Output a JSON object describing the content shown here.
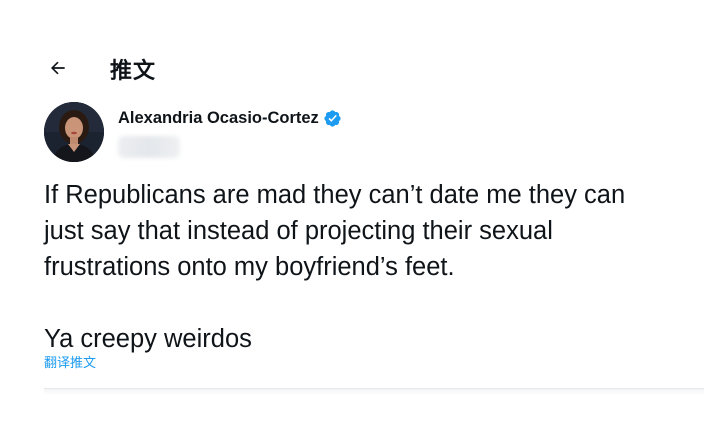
{
  "header": {
    "title": "推文",
    "back_icon": "arrow-left-icon"
  },
  "author": {
    "name": "Alexandria Ocasio-Cortez",
    "verified_icon": "verified-badge-icon",
    "verified_color": "#1d9bf0"
  },
  "tweet": {
    "lines": [
      "If Republicans are mad they can’t date me they can",
      "just say that instead of projecting their sexual",
      "frustrations onto my boyfriend’s feet."
    ],
    "closing_line": "Ya creepy weirdos",
    "translate_label": "翻译推文"
  },
  "colors": {
    "text": "#0f1419",
    "accent": "#1d9bf0",
    "divider": "#e6e8ea"
  }
}
